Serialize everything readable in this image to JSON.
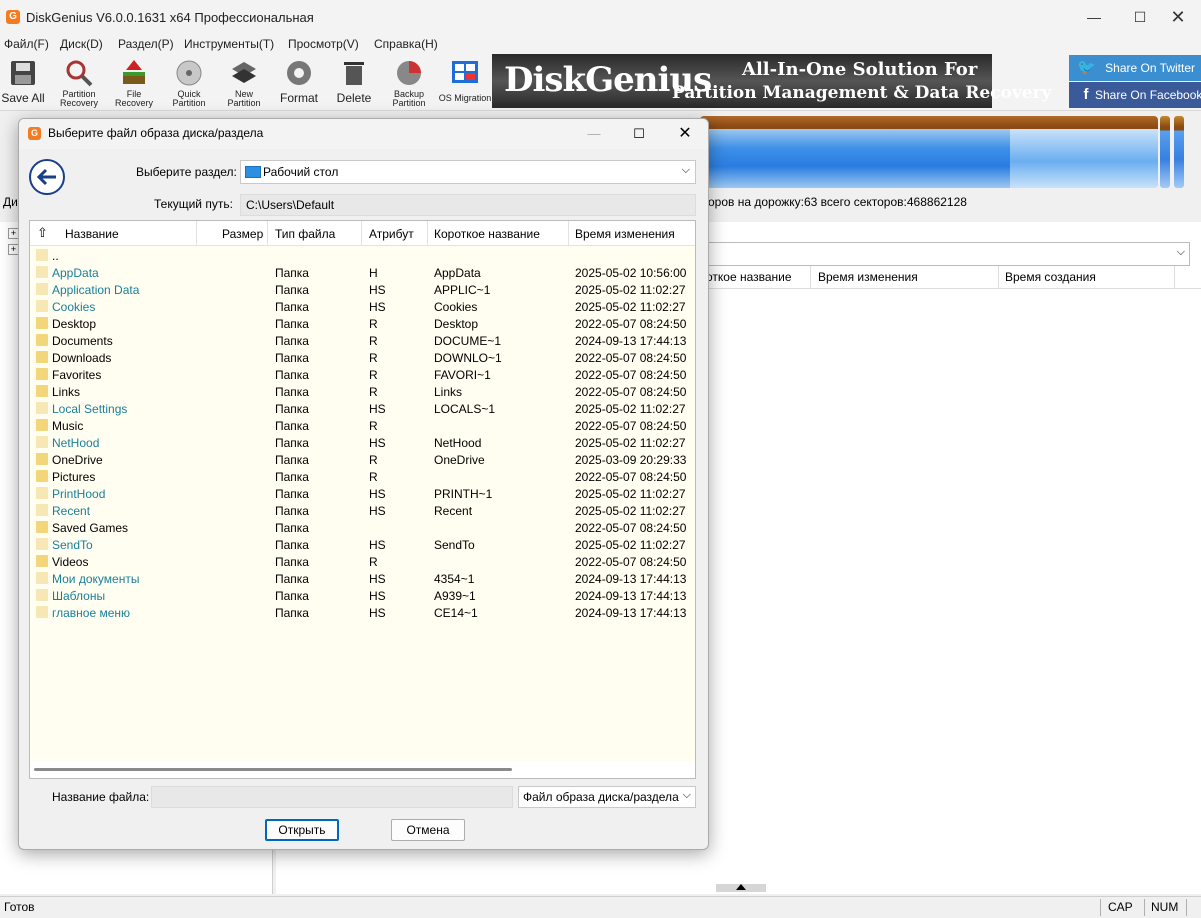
{
  "app": {
    "title": "DiskGenius V6.0.0.1631 x64 Профессиональная",
    "icon": "G"
  },
  "menu": [
    "Файл(F)",
    "Диск(D)",
    "Раздел(P)",
    "Инструменты(T)",
    "Просмотр(V)",
    "Справка(H)"
  ],
  "toolbar": {
    "save_all": "Save All",
    "partition_recovery": [
      "Partition",
      "Recovery"
    ],
    "file_recovery": [
      "File",
      "Recovery"
    ],
    "quick_partition": [
      "Quick",
      "Partition"
    ],
    "new_partition": [
      "New",
      "Partition"
    ],
    "format": "Format",
    "delete": "Delete",
    "backup_partition": [
      "Backup",
      "Partition"
    ],
    "os_migration": "OS Migration"
  },
  "banner": {
    "logo": "DiskGenius",
    "line1": "All-In-One Solution For",
    "line2": "Partition Management & Data Recovery"
  },
  "share": {
    "twitter": "Share On Twitter",
    "facebook": "Share On Facebook"
  },
  "disk_info": "оров на дорожку:63  всего секторов:468862128",
  "left_panel_label": "Ди",
  "right_table_headers": [
    "откое название",
    "Время изменения",
    "Время создания"
  ],
  "status": {
    "ready": "Готов",
    "cap": "CAP",
    "num": "NUM"
  },
  "dialog": {
    "title": "Выберите файл образа диска/раздела",
    "select_partition_label": "Выберите раздел:",
    "selected_partition": "Рабочий стол",
    "current_path_label": "Текущий путь:",
    "current_path": "C:\\Users\\Default",
    "columns": [
      "Название",
      "Размер",
      "Тип файла",
      "Атрибут",
      "Короткое название",
      "Время изменения"
    ],
    "rows": [
      {
        "name": "..",
        "type": "",
        "attr": "",
        "short": "",
        "modified": "",
        "hidden": false
      },
      {
        "name": "AppData",
        "type": "Папка",
        "attr": "H",
        "short": "AppData",
        "modified": "2025-05-02 10:56:00",
        "hidden": true
      },
      {
        "name": "Application Data",
        "type": "Папка",
        "attr": "HS",
        "short": "APPLIC~1",
        "modified": "2025-05-02 11:02:27",
        "hidden": true
      },
      {
        "name": "Cookies",
        "type": "Папка",
        "attr": "HS",
        "short": "Cookies",
        "modified": "2025-05-02 11:02:27",
        "hidden": true
      },
      {
        "name": "Desktop",
        "type": "Папка",
        "attr": "R",
        "short": "Desktop",
        "modified": "2022-05-07 08:24:50",
        "hidden": false
      },
      {
        "name": "Documents",
        "type": "Папка",
        "attr": "R",
        "short": "DOCUME~1",
        "modified": "2024-09-13 17:44:13",
        "hidden": false
      },
      {
        "name": "Downloads",
        "type": "Папка",
        "attr": "R",
        "short": "DOWNLO~1",
        "modified": "2022-05-07 08:24:50",
        "hidden": false
      },
      {
        "name": "Favorites",
        "type": "Папка",
        "attr": "R",
        "short": "FAVORI~1",
        "modified": "2022-05-07 08:24:50",
        "hidden": false
      },
      {
        "name": "Links",
        "type": "Папка",
        "attr": "R",
        "short": "Links",
        "modified": "2022-05-07 08:24:50",
        "hidden": false
      },
      {
        "name": "Local Settings",
        "type": "Папка",
        "attr": "HS",
        "short": "LOCALS~1",
        "modified": "2025-05-02 11:02:27",
        "hidden": true
      },
      {
        "name": "Music",
        "type": "Папка",
        "attr": "R",
        "short": "",
        "modified": "2022-05-07 08:24:50",
        "hidden": false
      },
      {
        "name": "NetHood",
        "type": "Папка",
        "attr": "HS",
        "short": "NetHood",
        "modified": "2025-05-02 11:02:27",
        "hidden": true
      },
      {
        "name": "OneDrive",
        "type": "Папка",
        "attr": "R",
        "short": "OneDrive",
        "modified": "2025-03-09 20:29:33",
        "hidden": false
      },
      {
        "name": "Pictures",
        "type": "Папка",
        "attr": "R",
        "short": "",
        "modified": "2022-05-07 08:24:50",
        "hidden": false
      },
      {
        "name": "PrintHood",
        "type": "Папка",
        "attr": "HS",
        "short": "PRINTH~1",
        "modified": "2025-05-02 11:02:27",
        "hidden": true
      },
      {
        "name": "Recent",
        "type": "Папка",
        "attr": "HS",
        "short": "Recent",
        "modified": "2025-05-02 11:02:27",
        "hidden": true
      },
      {
        "name": "Saved Games",
        "type": "Папка",
        "attr": "",
        "short": "",
        "modified": "2022-05-07 08:24:50",
        "hidden": false
      },
      {
        "name": "SendTo",
        "type": "Папка",
        "attr": "HS",
        "short": "SendTo",
        "modified": "2025-05-02 11:02:27",
        "hidden": true
      },
      {
        "name": "Videos",
        "type": "Папка",
        "attr": "R",
        "short": "",
        "modified": "2022-05-07 08:24:50",
        "hidden": false
      },
      {
        "name": "Мои документы",
        "type": "Папка",
        "attr": "HS",
        "short": "4354~1",
        "modified": "2024-09-13 17:44:13",
        "hidden": true
      },
      {
        "name": "Шаблоны",
        "type": "Папка",
        "attr": "HS",
        "short": "A939~1",
        "modified": "2024-09-13 17:44:13",
        "hidden": true
      },
      {
        "name": "главное меню",
        "type": "Папка",
        "attr": "HS",
        "short": "CE14~1",
        "modified": "2024-09-13 17:44:13",
        "hidden": true
      }
    ],
    "file_name_label": "Название файла:",
    "file_name_value": "",
    "file_type": "Файл образа диска/раздела",
    "open_label": "Открыть",
    "cancel_label": "Отмена"
  },
  "colors": {
    "hidden_text": "#1a7f9a",
    "accent": "#0067c0",
    "twitter": "#3b8fd1",
    "facebook": "#3b5a9a",
    "brand_icon": "#f47b20"
  }
}
